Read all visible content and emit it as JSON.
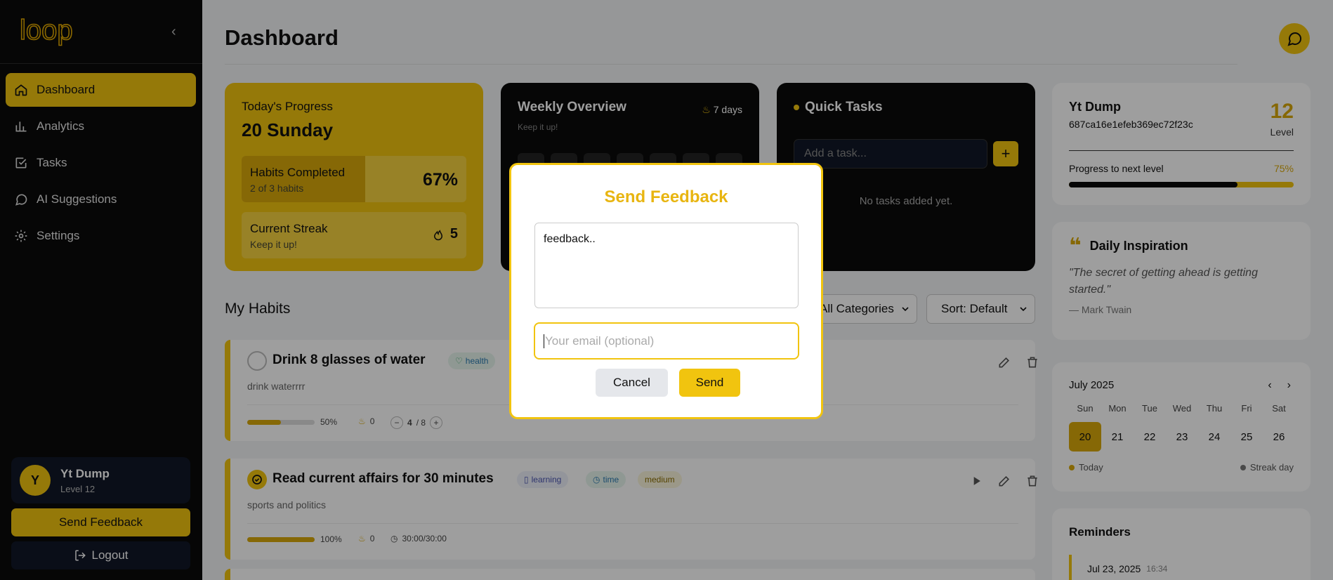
{
  "app": {
    "logo": "loop"
  },
  "sidebar": {
    "items": [
      {
        "label": "Dashboard",
        "icon": "home-icon",
        "active": true
      },
      {
        "label": "Analytics",
        "icon": "bar-chart-icon"
      },
      {
        "label": "Tasks",
        "icon": "check-square-icon"
      },
      {
        "label": "AI Suggestions",
        "icon": "message-circle-icon"
      },
      {
        "label": "Settings",
        "icon": "gear-icon"
      }
    ],
    "user": {
      "initial": "Y",
      "name": "Yt Dump",
      "level": "Level 12"
    },
    "feedback_label": "Send Feedback",
    "logout_label": "Logout"
  },
  "header": {
    "title": "Dashboard"
  },
  "progress": {
    "label": "Today's Progress",
    "day": "20 Sunday",
    "habits_title": "Habits Completed",
    "habits_sub": "2 of 3 habits",
    "habits_pct": "67%",
    "habits_fraction": 0.67,
    "streak_title": "Current Streak",
    "streak_sub": "Keep it up!",
    "streak_value": "5"
  },
  "weekly": {
    "title": "Weekly Overview",
    "days": "7 days",
    "sub": "Keep it up!"
  },
  "quick": {
    "title": "Quick Tasks",
    "placeholder": "Add a task...",
    "empty": "No tasks added yet."
  },
  "habits": {
    "title": "My Habits",
    "category": "All Categories",
    "sort": "Sort: Default",
    "list": [
      {
        "title": "Drink 8 glasses of water",
        "desc": "drink waterrrr",
        "tags": [
          "health"
        ],
        "pct": "50%",
        "fraction": 0.5,
        "streak": "0",
        "count": "4",
        "total": "/ 8"
      },
      {
        "title": "Read current affairs for 30 minutes",
        "desc": "sports and politics",
        "tags": [
          "learning",
          "time",
          "medium"
        ],
        "pct": "100%",
        "fraction": 1.0,
        "streak": "0",
        "timer": "30:00/30:00"
      }
    ]
  },
  "profile": {
    "name": "Yt Dump",
    "id": "687ca16e1efeb369ec72f23c",
    "level": "12",
    "level_label": "Level",
    "progress_label": "Progress to next level",
    "progress_pct": "75%",
    "progress_fraction": 0.75
  },
  "inspiration": {
    "title": "Daily Inspiration",
    "quote": "\"The secret of getting ahead is getting started.\"",
    "author": "— Mark Twain"
  },
  "calendar": {
    "month": "July 2025",
    "weekdays": [
      "Sun",
      "Mon",
      "Tue",
      "Wed",
      "Thu",
      "Fri",
      "Sat"
    ],
    "days": [
      "20",
      "21",
      "22",
      "23",
      "24",
      "25",
      "26"
    ],
    "today_label": "Today",
    "streak_label": "Streak day"
  },
  "reminders": {
    "title": "Reminders",
    "item_date": "Jul 23, 2025",
    "item_time": "16:34"
  },
  "modal": {
    "title": "Send Feedback",
    "feedback_value": "feedback..",
    "email_placeholder": "Your email (optional)",
    "cancel": "Cancel",
    "send": "Send"
  },
  "colors": {
    "accent": "#f1c40f",
    "dark": "#0a0a0a"
  }
}
